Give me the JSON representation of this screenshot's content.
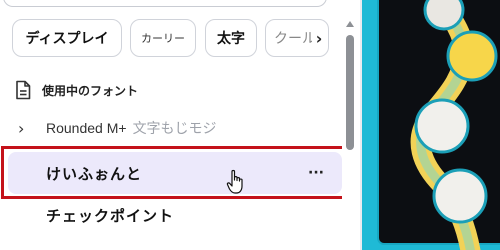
{
  "filter_chips": {
    "display": "ディスプレイ",
    "curly": "カーリー",
    "bold": "太字",
    "cool": "クール",
    "next_icon": "chevron-right-icon"
  },
  "used_fonts": {
    "section_title": "使用中のフォント",
    "section_icon": "document-icon",
    "rounded": {
      "name": "Rounded M+",
      "sample": "文字もじモジ"
    },
    "selected": {
      "name": "けいふぉんと",
      "more": "···"
    },
    "next_font": "チェックポイント"
  },
  "colors": {
    "selected_bg": "#ece9fb",
    "highlight": "#c4121a",
    "canvas_cyan": "#1fbad6",
    "canvas_yellow": "#f7d64a"
  }
}
